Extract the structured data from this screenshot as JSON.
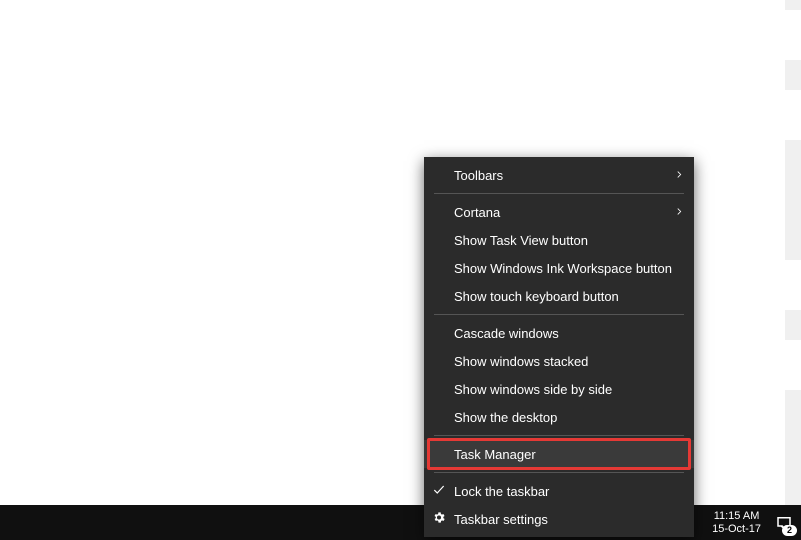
{
  "context_menu": {
    "items": [
      {
        "label": "Toolbars",
        "submenu": true
      },
      {
        "label": "Cortana",
        "submenu": true,
        "sep_before": true
      },
      {
        "label": "Show Task View button"
      },
      {
        "label": "Show Windows Ink Workspace button"
      },
      {
        "label": "Show touch keyboard button"
      },
      {
        "label": "Cascade windows",
        "sep_before": true
      },
      {
        "label": "Show windows stacked"
      },
      {
        "label": "Show windows side by side"
      },
      {
        "label": "Show the desktop"
      },
      {
        "label": "Task Manager",
        "sep_before": true,
        "highlight": true
      },
      {
        "label": "Lock the taskbar",
        "checked": true,
        "sep_before": true
      },
      {
        "label": "Taskbar settings",
        "icon": "gear"
      }
    ]
  },
  "tray": {
    "time": "11:15 AM",
    "date": "15-Oct-17",
    "action_center_count": "2"
  },
  "colors": {
    "menu_bg": "#2b2b2b",
    "highlight": "#e53935"
  }
}
